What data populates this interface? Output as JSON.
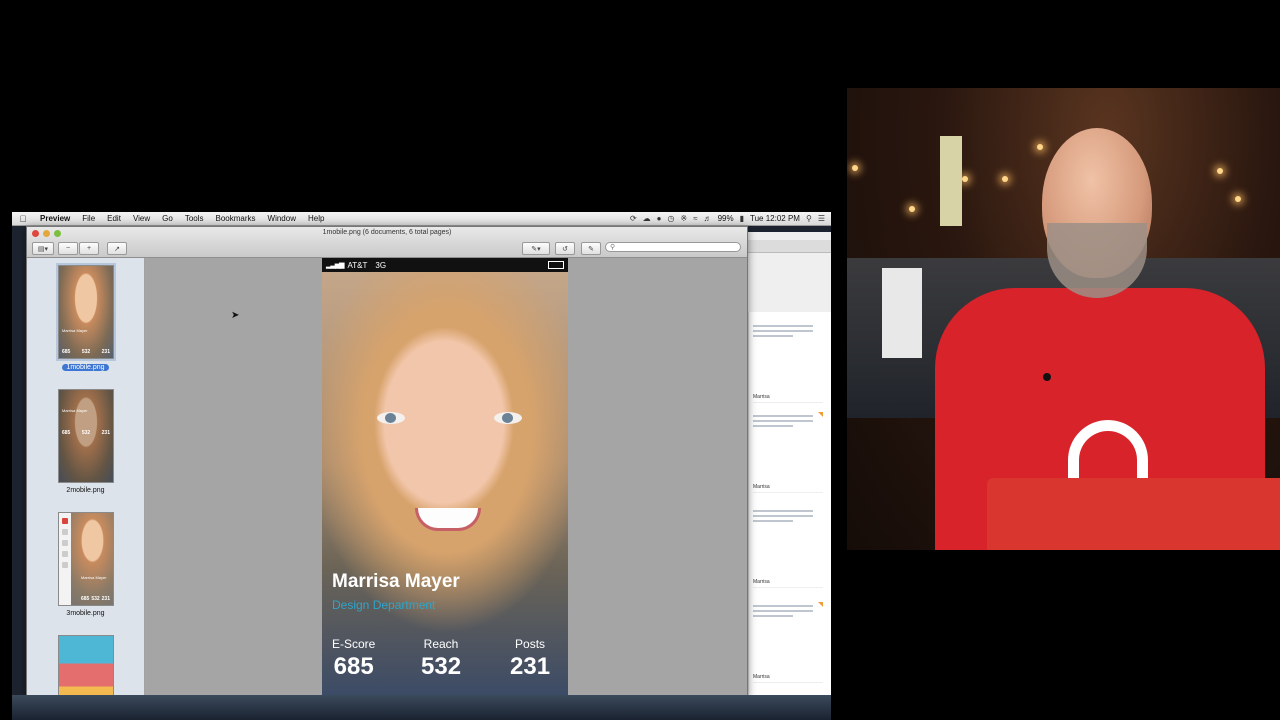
{
  "menubar": {
    "app": "Preview",
    "menus": [
      "File",
      "Edit",
      "View",
      "Go",
      "Tools",
      "Bookmarks",
      "Window",
      "Help"
    ],
    "battery": "99%",
    "clock": "Tue 12:02 PM"
  },
  "window": {
    "title": "1mobile.png (6 documents, 6 total pages)",
    "search_placeholder": ""
  },
  "sidebar": {
    "thumbnails": [
      {
        "label": "1mobile.png",
        "name_text": "Marrisa Mayer",
        "nums": [
          "685",
          "532",
          "231"
        ],
        "selected": true
      },
      {
        "label": "2mobile.png",
        "name_text": "Marrisa Mayer",
        "nums": [
          "685",
          "532",
          "231"
        ],
        "selected": false
      },
      {
        "label": "3mobile.png",
        "name_text": "Marrisa Mayer",
        "nums": [
          "685",
          "532",
          "231"
        ],
        "selected": false
      },
      {
        "label": "",
        "selected": false
      }
    ]
  },
  "phone": {
    "carrier": "AT&T",
    "network": "3G",
    "name": "Marrisa Mayer",
    "department": "Design Department",
    "stats": [
      {
        "label": "E-Score",
        "value": "685"
      },
      {
        "label": "Reach",
        "value": "532"
      },
      {
        "label": "Posts",
        "value": "231"
      }
    ]
  },
  "background_app": {
    "tweets": [
      {
        "user": "Marrisa",
        "flag": false
      },
      {
        "user": "Marrisa",
        "flag": true
      },
      {
        "user": "Marrisa",
        "flag": false
      },
      {
        "user": "Marrisa",
        "flag": true
      }
    ]
  },
  "colors": {
    "selection": "#3d77d3",
    "department_text": "#2fa5c9",
    "shirt_red": "#d8232a"
  }
}
